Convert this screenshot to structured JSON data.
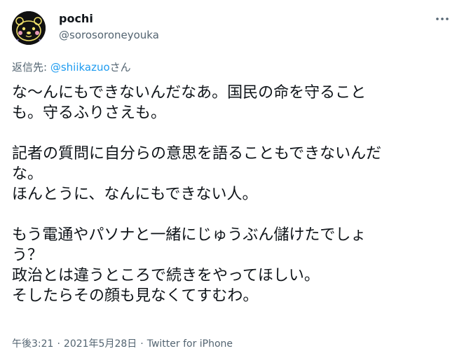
{
  "user": {
    "display_name": "pochi",
    "handle": "@sorosoroneyouka"
  },
  "reply": {
    "prefix": "返信先: ",
    "mention": "@shiikazuo",
    "suffix": "さん"
  },
  "tweet": {
    "lines": [
      "な〜んにもできないんだなあ。国民の命を守ること",
      "も。守るふりさえも。",
      "",
      "記者の質問に自分らの意思を語ることもできないんだ",
      "な。",
      "ほんとうに、なんにもできない人。",
      "",
      "もう電通やパソナと一緒にじゅうぶん儲けたでしょ",
      "う？",
      "政治とは違うところで続きをやってほしい。",
      "そしたらその顔も見なくてすむわ。"
    ]
  },
  "meta": {
    "time": "午後3:21",
    "separator": "·",
    "date": "2021年5月28日",
    "source": "Twitter for iPhone"
  },
  "icons": {
    "more": "more-horizontal-icon"
  },
  "colors": {
    "text": "#0f1419",
    "secondary": "#536471",
    "link": "#1d9bf0"
  }
}
